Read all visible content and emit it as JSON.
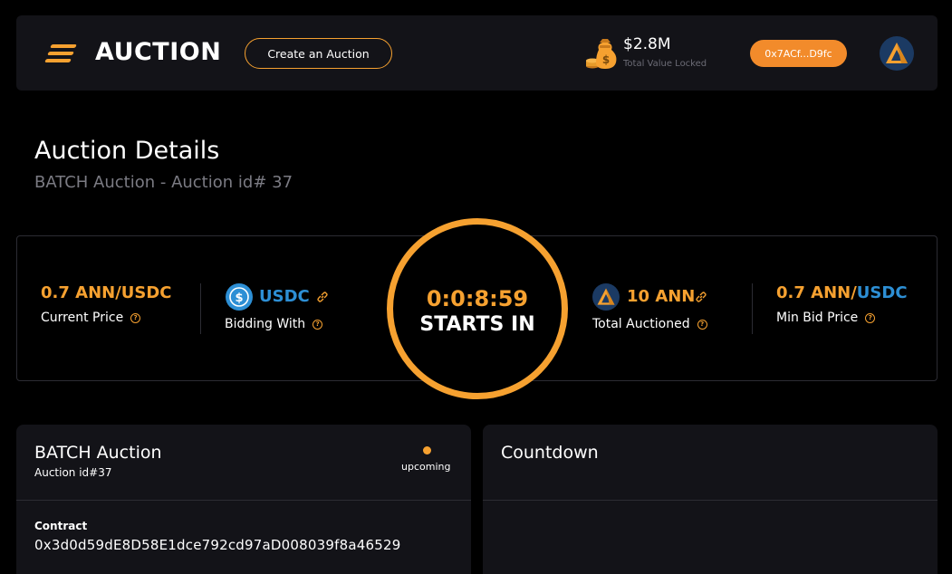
{
  "header": {
    "brand": "AUCTION",
    "create_button": "Create an Auction",
    "tvl_value": "$2.8M",
    "tvl_label": "Total Value Locked",
    "wallet": "0x7ACf...D9fc",
    "icons": {
      "menu": "menu-icon",
      "tvl": "money-bag-icon",
      "avatar": "ann-token-icon"
    }
  },
  "page": {
    "title": "Auction Details",
    "subtitle": "BATCH Auction - Auction id# 37"
  },
  "stats": {
    "current_price": {
      "value": "0.7 ANN/USDC",
      "label": "Current Price"
    },
    "bidding_with": {
      "value": "USDC",
      "label": "Bidding With"
    },
    "countdown": {
      "time": "0:0:8:59",
      "label": "STARTS IN"
    },
    "total_auctioned": {
      "value": "10 ANN",
      "label": "Total Auctioned"
    },
    "min_bid_price": {
      "value_ann": "0.7 ANN/",
      "value_usdc": "USDC",
      "label": "Min Bid Price"
    }
  },
  "auction_card": {
    "title": "BATCH Auction",
    "subtitle": "Auction id#37",
    "status": "upcoming",
    "contract_label": "Contract",
    "contract_address": "0x3d0d59dE8D58E1dce792cd97aD008039f8a46529"
  },
  "countdown_card": {
    "title": "Countdown"
  },
  "colors": {
    "accent": "#f6a130",
    "wallet": "#f28b2b",
    "usdc_blue": "#2d8fd5",
    "card_bg": "#131318",
    "page_bg": "#000000"
  }
}
